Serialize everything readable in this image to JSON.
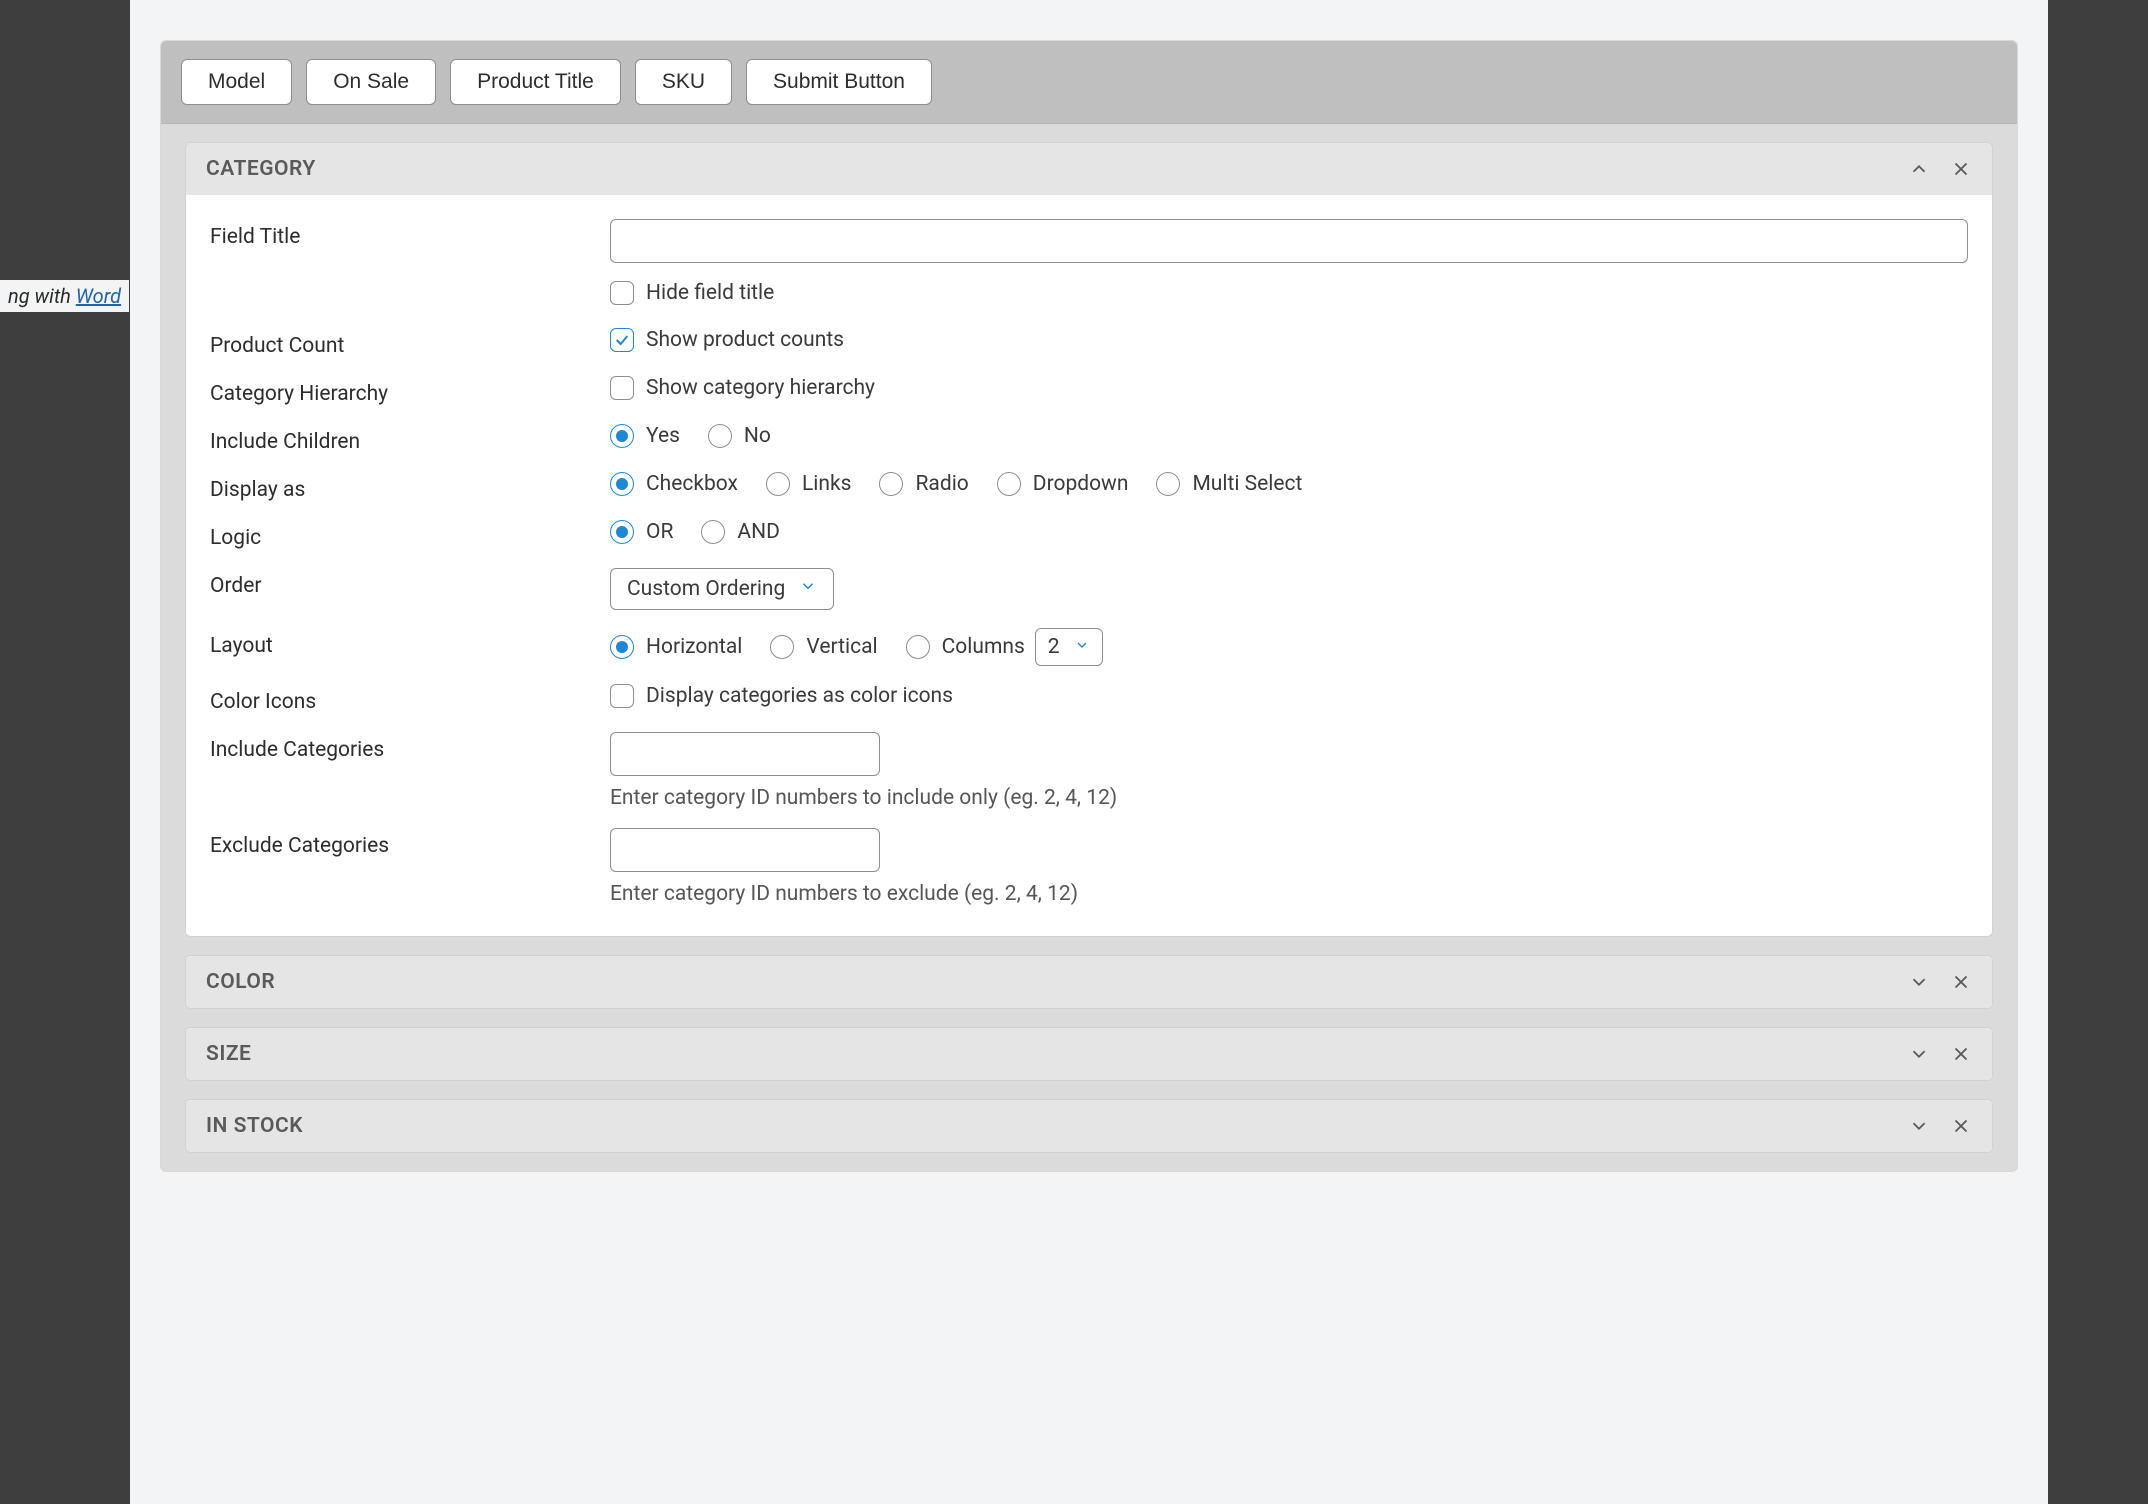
{
  "bg_note_prefix": "ng with ",
  "bg_note_link": "Word",
  "toolbar": {
    "buttons": [
      "Model",
      "On Sale",
      "Product Title",
      "SKU",
      "Submit Button"
    ]
  },
  "sections": {
    "category": {
      "title": "CATEGORY",
      "expanded": true,
      "fields": {
        "field_title": {
          "label": "Field Title",
          "value": ""
        },
        "hide_title": {
          "label": "Hide field title",
          "checked": false
        },
        "product_count": {
          "label": "Product Count",
          "option_label": "Show product counts",
          "checked": true
        },
        "category_hierarchy": {
          "label": "Category Hierarchy",
          "option_label": "Show category hierarchy",
          "checked": false
        },
        "include_children": {
          "label": "Include Children",
          "options": [
            "Yes",
            "No"
          ],
          "selected": "Yes"
        },
        "display_as": {
          "label": "Display as",
          "options": [
            "Checkbox",
            "Links",
            "Radio",
            "Dropdown",
            "Multi Select"
          ],
          "selected": "Checkbox"
        },
        "logic": {
          "label": "Logic",
          "options": [
            "OR",
            "AND"
          ],
          "selected": "OR"
        },
        "order": {
          "label": "Order",
          "selected": "Custom Ordering"
        },
        "layout": {
          "label": "Layout",
          "options": [
            "Horizontal",
            "Vertical",
            "Columns"
          ],
          "selected": "Horizontal",
          "columns_value": "2"
        },
        "color_icons": {
          "label": "Color Icons",
          "option_label": "Display categories as color icons",
          "checked": false
        },
        "include_categories": {
          "label": "Include Categories",
          "value": "",
          "help": "Enter category ID numbers to include only (eg. 2, 4, 12)"
        },
        "exclude_categories": {
          "label": "Exclude Categories",
          "value": "",
          "help": "Enter category ID numbers to exclude (eg. 2, 4, 12)"
        }
      }
    },
    "color": {
      "title": "COLOR",
      "expanded": false
    },
    "size": {
      "title": "SIZE",
      "expanded": false
    },
    "in_stock": {
      "title": "IN STOCK",
      "expanded": false
    }
  }
}
